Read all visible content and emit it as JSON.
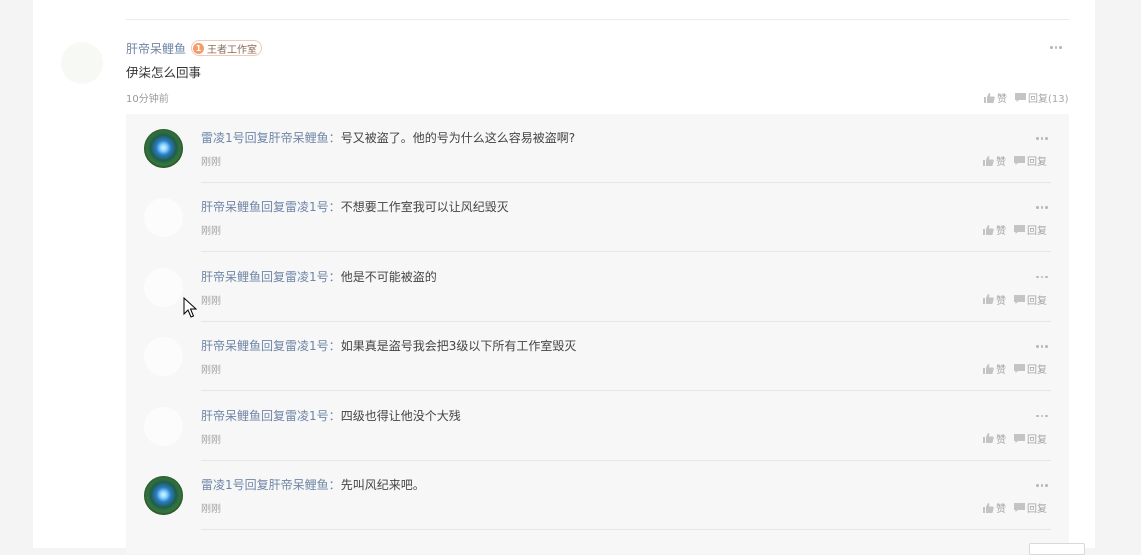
{
  "comment": {
    "author": "肝帝呆鲤鱼",
    "badge": {
      "number": "1",
      "label": "王者工作室"
    },
    "text": "伊柒怎么回事",
    "time": "10分钟前",
    "like_label": "赞",
    "reply_label": "回复(13)"
  },
  "reply_word": "回复",
  "colon": "：",
  "like_label": "赞",
  "reply_action_label": "回复",
  "replies": [
    {
      "from": "雷凌1号",
      "to": "肝帝呆鲤鱼",
      "text": "号又被盗了。他的号为什么这么容易被盗啊?",
      "time": "刚刚",
      "avatar": "photo"
    },
    {
      "from": "肝帝呆鲤鱼",
      "to": "雷凌1号",
      "text": "不想要工作室我可以让风纪毁灭",
      "time": "刚刚",
      "avatar": "blank"
    },
    {
      "from": "肝帝呆鲤鱼",
      "to": "雷凌1号",
      "text": "他是不可能被盗的",
      "time": "刚刚",
      "avatar": "blank"
    },
    {
      "from": "肝帝呆鲤鱼",
      "to": "雷凌1号",
      "text": "如果真是盗号我会把3级以下所有工作室毁灭",
      "time": "刚刚",
      "avatar": "blank"
    },
    {
      "from": "肝帝呆鲤鱼",
      "to": "雷凌1号",
      "text": "四级也得让他没个大残",
      "time": "刚刚",
      "avatar": "blank"
    },
    {
      "from": "雷凌1号",
      "to": "肝帝呆鲤鱼",
      "text": "先叫风纪来吧。",
      "time": "刚刚",
      "avatar": "photo"
    }
  ]
}
